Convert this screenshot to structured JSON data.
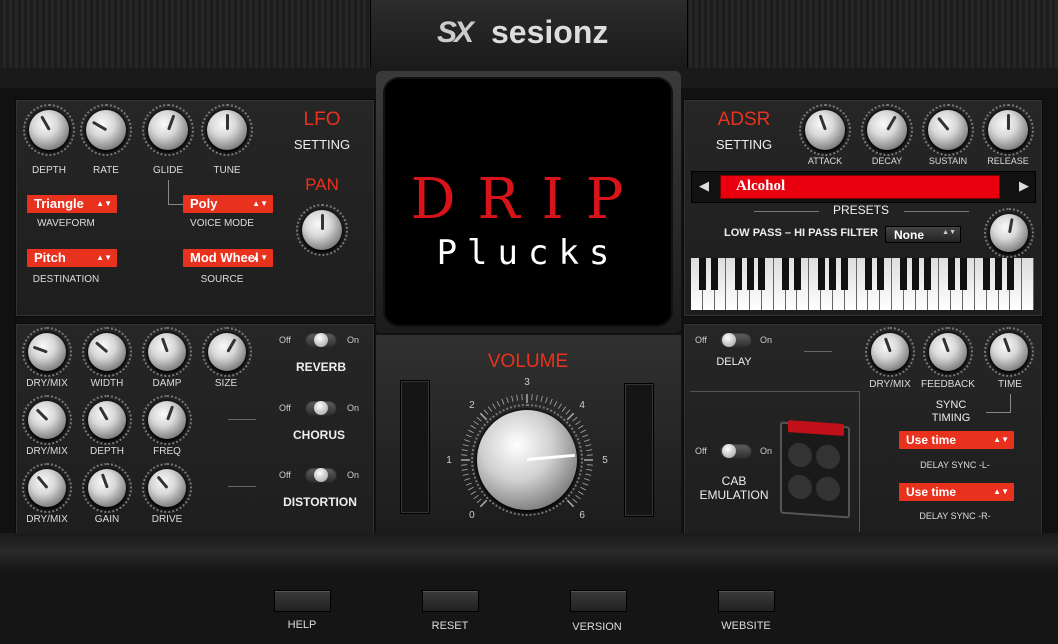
{
  "brand": {
    "logo_mark": "SX",
    "logo_text": "sesionz"
  },
  "lfo": {
    "title": "LFO",
    "subtitle": "SETTING",
    "knobs": [
      "DEPTH",
      "RATE",
      "GLIDE",
      "TUNE"
    ],
    "waveform": {
      "value": "Triangle",
      "label": "WAVEFORM"
    },
    "voice_mode": {
      "value": "Poly",
      "label": "VOICE MODE"
    },
    "destination": {
      "value": "Pitch",
      "label": "DESTINATION"
    },
    "source": {
      "value": "Mod Wheel",
      "label": "SOURCE"
    },
    "pan_title": "PAN"
  },
  "display": {
    "title_line1": "DRIP",
    "title_line2": "Plucks"
  },
  "adsr": {
    "title": "ADSR",
    "subtitle": "SETTING",
    "knobs": [
      "ATTACK",
      "DECAY",
      "SUSTAIN",
      "RELEASE"
    ],
    "preset_value": "Alcohol",
    "preset_label": "PRESETS",
    "filter_label": "LOW PASS – HI PASS FILTER",
    "filter_value": "None"
  },
  "effects": {
    "reverb": {
      "name": "REVERB",
      "knobs": [
        "DRY/MIX",
        "WIDTH",
        "DAMP",
        "SIZE"
      ]
    },
    "chorus": {
      "name": "CHORUS",
      "knobs": [
        "DRY/MIX",
        "DEPTH",
        "FREQ"
      ]
    },
    "distortion": {
      "name": "DISTORTION",
      "knobs": [
        "DRY/MIX",
        "GAIN",
        "DRIVE"
      ]
    },
    "off": "Off",
    "on": "On"
  },
  "volume": {
    "title": "VOLUME",
    "ticks": [
      "0",
      "1",
      "2",
      "3",
      "4",
      "5",
      "6"
    ]
  },
  "delay": {
    "name": "DELAY",
    "knobs": [
      "DRY/MIX",
      "FEEDBACK",
      "TIME"
    ],
    "sync_title": "SYNC\nTIMING",
    "sync_l": {
      "value": "Use time",
      "label": "DELAY SYNC -L-"
    },
    "sync_r": {
      "value": "Use time",
      "label": "DELAY SYNC -R-"
    },
    "cab_label": "CAB\nEMULATION"
  },
  "footer": {
    "buttons": [
      "HELP",
      "RESET",
      "VERSION",
      "WEBSITE"
    ]
  },
  "colors": {
    "accent": "#e8321e",
    "background": "#111111",
    "panel": "#222222"
  }
}
